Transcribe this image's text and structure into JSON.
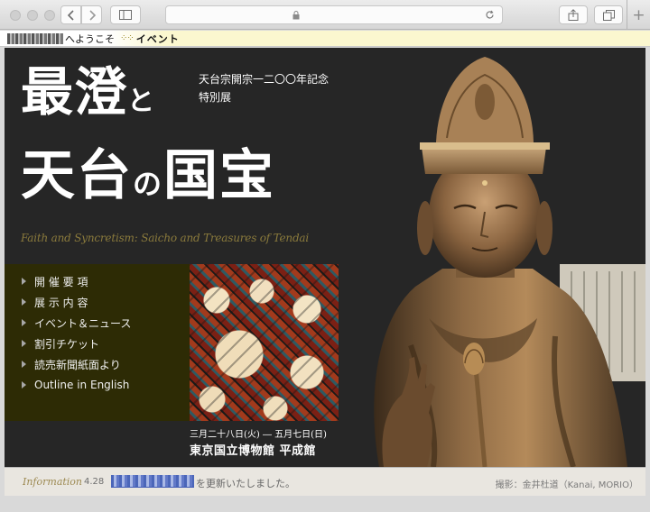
{
  "browser": {
    "back_icon": "chevron-left-icon",
    "forward_icon": "chevron-right-icon",
    "sidebar_icon": "sidebar-icon",
    "lock_icon": "lock-icon",
    "reload_icon": "reload-icon",
    "share_icon": "share-icon",
    "tabs_icon": "tabs-icon",
    "newtab_label": "+"
  },
  "breadcrumb": {
    "greeting": "へようこそ",
    "section": "イベント"
  },
  "hero": {
    "title_part1": "最澄",
    "title_connector1": "と",
    "title_part2": "天台",
    "title_connector2": "の",
    "title_part3": "国宝",
    "commemoration": "天台宗開宗一二〇〇年記念",
    "exhibition_type": "特別展",
    "english_title": "Faith and Syncretism: Saicho and Treasures of Tendai"
  },
  "menu": {
    "items": [
      {
        "label": "開 催 要 項"
      },
      {
        "label": "展 示 内 容"
      },
      {
        "label": "イベント＆ニュース"
      },
      {
        "label": "割引チケット"
      },
      {
        "label": "読売新聞紙面より"
      },
      {
        "label": "Outline in English"
      }
    ]
  },
  "exhibition": {
    "dates": "三月二十八日(火) ― 五月七日(日)",
    "venue": "東京国立博物館 平成館"
  },
  "info": {
    "label": "Information",
    "date": "4.28",
    "link_text": "読売新聞紙面より",
    "message": "を更新いたしました。",
    "credit": "撮影：金井杜道（Kanai, MORIO）"
  }
}
